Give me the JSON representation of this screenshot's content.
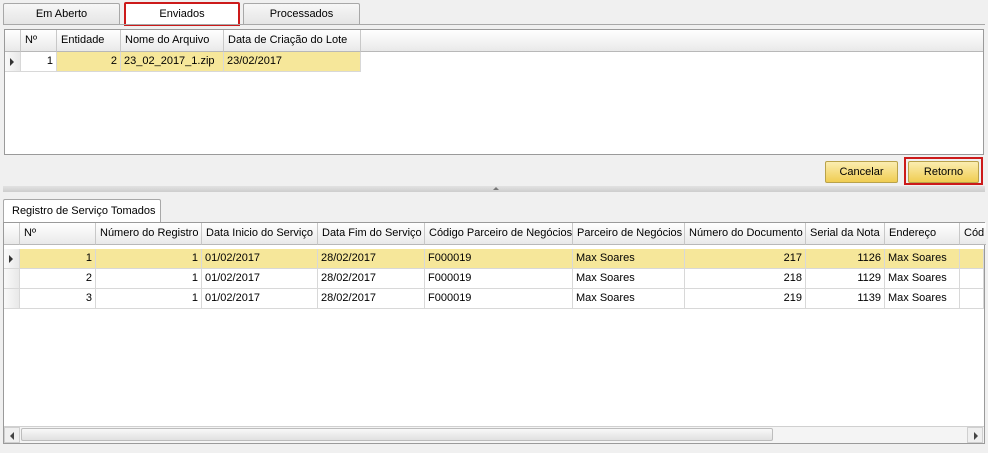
{
  "tabs": [
    {
      "label": "Em Aberto"
    },
    {
      "label": "Enviados"
    },
    {
      "label": "Processados"
    }
  ],
  "lotes": {
    "headers": [
      "Nº",
      "Entidade",
      "Nome do Arquivo",
      "Data de Criação do Lote"
    ],
    "rows": [
      [
        "1",
        "2",
        "23_02_2017_1.zip",
        "23/02/2017"
      ]
    ]
  },
  "buttons": {
    "cancel": "Cancelar",
    "return": "Retorno"
  },
  "detail_tab": {
    "label": "Registro de Serviço Tomados"
  },
  "registros": {
    "headers": [
      "Nº",
      "Número do Registro",
      "Data Inicio do Serviço",
      "Data Fim do Serviço",
      "Código Parceiro de Negócios",
      "Parceiro de Negócios",
      "Número do Documento",
      "Serial da Nota",
      "Endereço",
      "Cód"
    ],
    "rows": [
      [
        "1",
        "1",
        "01/02/2017",
        "28/02/2017",
        "F000019",
        "Max Soares",
        "217",
        "1126",
        "Max Soares"
      ],
      [
        "2",
        "1",
        "01/02/2017",
        "28/02/2017",
        "F000019",
        "Max Soares",
        "218",
        "1129",
        "Max Soares"
      ],
      [
        "3",
        "1",
        "01/02/2017",
        "28/02/2017",
        "F000019",
        "Max Soares",
        "219",
        "1139",
        "Max Soares"
      ]
    ]
  },
  "icons": {
    "row_indicator": "arrow-right-icon",
    "scroll_left": "arrow-left-icon",
    "scroll_right": "arrow-right-icon"
  },
  "colors": {
    "selected_row": "#f6e79a",
    "highlight_border": "#cc1a1a",
    "button": "#f0cd52"
  }
}
